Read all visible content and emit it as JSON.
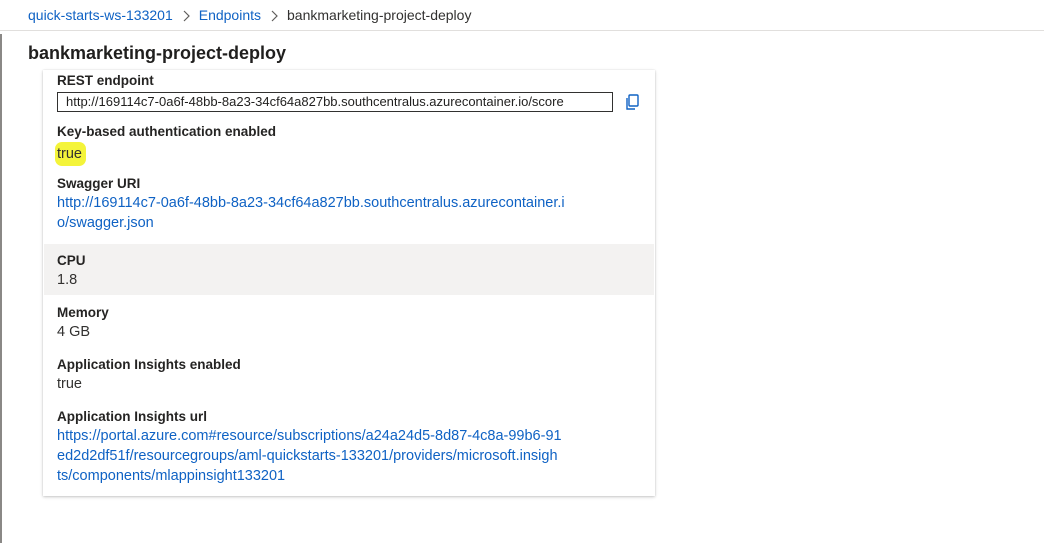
{
  "breadcrumb": {
    "workspace": "quick-starts-ws-133201",
    "endpoints": "Endpoints",
    "current": "bankmarketing-project-deploy"
  },
  "page": {
    "title": "bankmarketing-project-deploy"
  },
  "details": {
    "rest_endpoint": {
      "label": "REST endpoint",
      "value": "http://169114c7-0a6f-48bb-8a23-34cf64a827bb.southcentralus.azurecontainer.io/score"
    },
    "key_auth": {
      "label": "Key-based authentication enabled",
      "value": "true"
    },
    "swagger": {
      "label": "Swagger URI",
      "line1": "http://169114c7-0a6f-48bb-8a23-34cf64a827bb.southcentralus.azurecontainer.i",
      "line2": "o/swagger.json"
    },
    "cpu": {
      "label": "CPU",
      "value": "1.8"
    },
    "memory": {
      "label": "Memory",
      "value": "4 GB"
    },
    "app_insights_enabled": {
      "label": "Application Insights enabled",
      "value": "true"
    },
    "app_insights_url": {
      "label": "Application Insights url",
      "line1": "https://portal.azure.com#resource/subscriptions/a24a24d5-8d87-4c8a-99b6-91",
      "line2": "ed2d2df51f/resourcegroups/aml-quickstarts-133201/providers/microsoft.insigh",
      "line3": "ts/components/mlappinsight133201"
    }
  },
  "colors": {
    "link": "#0f62c4",
    "highlight": "#f4f43a",
    "band": "#f3f2f1",
    "text": "#201f1e"
  },
  "icons": {
    "copy": "copy-icon",
    "chevron": "chevron-right-icon"
  }
}
